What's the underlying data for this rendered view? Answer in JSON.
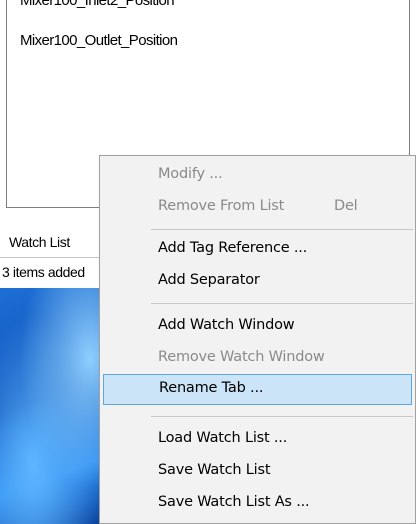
{
  "watch_list": {
    "items": [
      "Mixer100_Inlet2_Position",
      "Mixer100_Outlet_Position"
    ],
    "tab_label": "Watch List",
    "status_text": "3 items added"
  },
  "context_menu": {
    "items": [
      {
        "label": "Modify ...",
        "shortcut": "",
        "enabled": false
      },
      {
        "label": "Remove From List",
        "shortcut": "Del",
        "enabled": false
      },
      {
        "label": "Add Tag Reference ...",
        "shortcut": "",
        "enabled": true
      },
      {
        "label": "Add Separator",
        "shortcut": "",
        "enabled": true
      },
      {
        "label": "Add Watch Window",
        "shortcut": "",
        "enabled": true
      },
      {
        "label": "Remove Watch Window",
        "shortcut": "",
        "enabled": false
      },
      {
        "label": "Rename Tab ...",
        "shortcut": "",
        "enabled": true,
        "highlighted": true
      },
      {
        "label": "Load Watch List ...",
        "shortcut": "",
        "enabled": true
      },
      {
        "label": "Save Watch List",
        "shortcut": "",
        "enabled": true
      },
      {
        "label": "Save Watch List As ...",
        "shortcut": "",
        "enabled": true
      }
    ]
  },
  "colors": {
    "menu_background": "#f2f2f2",
    "highlight_fill": "#cce4f7",
    "highlight_border": "#5ea6dc",
    "disabled_text": "#8a8a8a",
    "wallpaper_blue": "#1d6fd6"
  }
}
